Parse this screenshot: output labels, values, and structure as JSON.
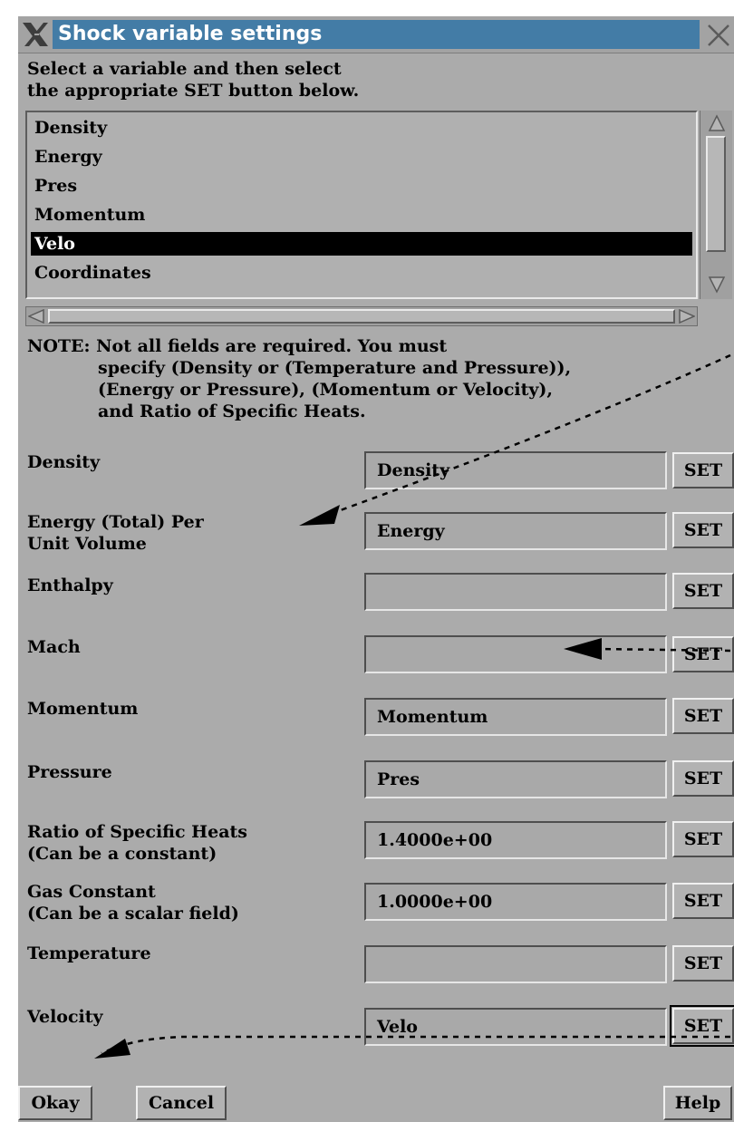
{
  "window": {
    "title": "Shock variable settings"
  },
  "instructions": {
    "line1": "Select a variable and then select",
    "line2": "the appropriate SET button below."
  },
  "variable_list": {
    "items": [
      "Density",
      "Energy",
      "Pres",
      "Momentum",
      "Velo",
      "Coordinates"
    ],
    "selected": "Velo"
  },
  "note": {
    "line1": "NOTE: Not all fields are required.  You must",
    "line2": "specify (Density or (Temperature and Pressure)),",
    "line3": "(Energy or Pressure), (Momentum or Velocity),",
    "line4": "and Ratio of Specific Heats."
  },
  "fields": [
    {
      "label": "Density",
      "label2": "",
      "value": "Density",
      "button": "SET"
    },
    {
      "label": "Energy (Total) Per",
      "label2": "Unit Volume",
      "value": "Energy",
      "button": "SET"
    },
    {
      "label": "Enthalpy",
      "label2": "",
      "value": "",
      "button": "SET"
    },
    {
      "label": "Mach",
      "label2": "",
      "value": "",
      "button": "SET"
    },
    {
      "label": "Momentum",
      "label2": "",
      "value": "Momentum",
      "button": "SET"
    },
    {
      "label": "Pressure",
      "label2": "",
      "value": "Pres",
      "button": "SET"
    },
    {
      "label": "Ratio of Specific Heats",
      "label2": "(Can be a constant)",
      "value": "1.4000e+00",
      "button": "SET"
    },
    {
      "label": "Gas Constant",
      "label2": "(Can be a scalar field)",
      "value": "1.0000e+00",
      "button": "SET"
    },
    {
      "label": "Temperature",
      "label2": "",
      "value": "",
      "button": "SET"
    },
    {
      "label": "Velocity",
      "label2": "",
      "value": "Velo",
      "button": "SET"
    }
  ],
  "buttons": {
    "okay": "Okay",
    "cancel": "Cancel",
    "help": "Help"
  },
  "colors": {
    "title_bar": "#437ca6",
    "dialog_bg": "#ababab",
    "selection": "#000000"
  }
}
